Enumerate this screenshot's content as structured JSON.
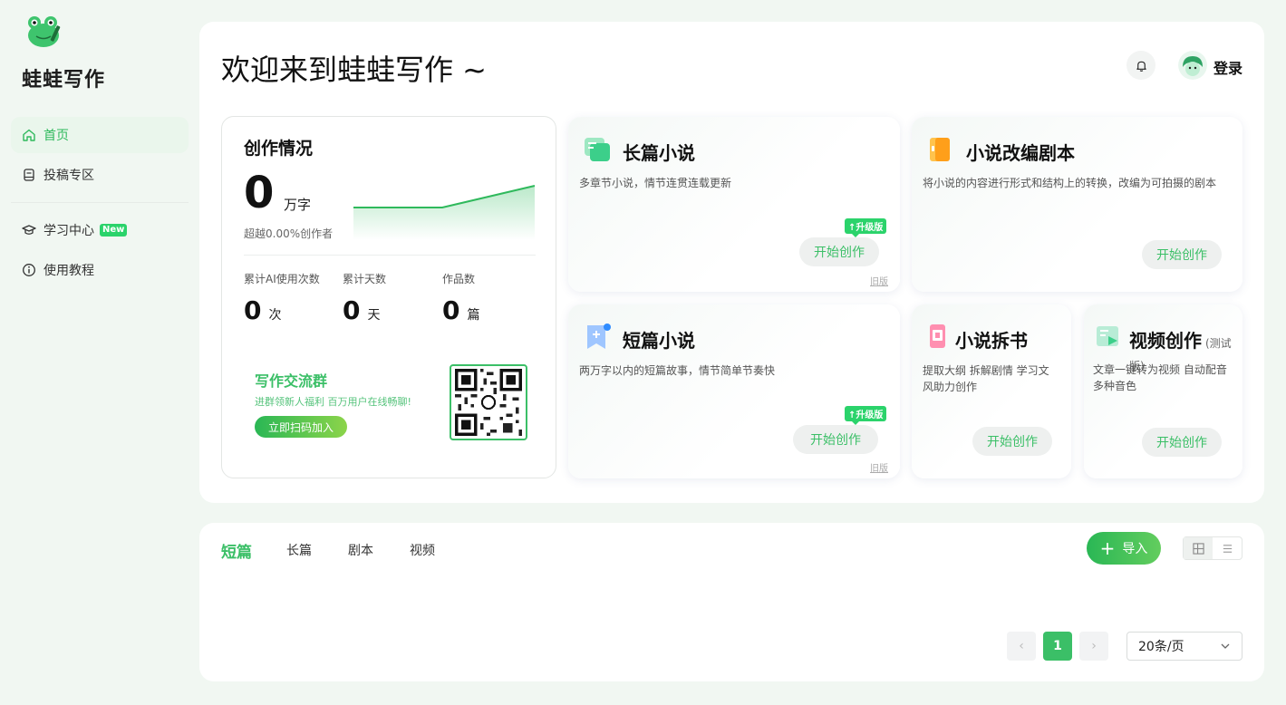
{
  "brand": {
    "name": "蛙蛙写作"
  },
  "sidebar": {
    "items": [
      {
        "label": "首页",
        "icon": "home-icon",
        "active": true
      },
      {
        "label": "投稿专区",
        "icon": "submit-icon"
      },
      {
        "label": "学习中心",
        "icon": "graduation-cap-icon",
        "badge": "New"
      },
      {
        "label": "使用教程",
        "icon": "info-icon"
      }
    ]
  },
  "header": {
    "welcome": "欢迎来到蛙蛙写作 ~",
    "login": "登录"
  },
  "stats": {
    "title": "创作情况",
    "words": "0",
    "words_unit": "万字",
    "beat": "超越0.00%创作者",
    "metrics": [
      {
        "label": "累计AI使用次数",
        "value": "0",
        "unit": "次"
      },
      {
        "label": "累计天数",
        "value": "0",
        "unit": "天"
      },
      {
        "label": "作品数",
        "value": "0",
        "unit": "篇"
      }
    ],
    "group_title": "写作交流群",
    "group_sub": "进群领新人福利 百万用户在线畅聊!",
    "join_label": "立即扫码加入"
  },
  "cards": {
    "long": {
      "title": "长篇小说",
      "desc": "多章节小说，情节连贯连载更新",
      "badge": "升级版",
      "button": "开始创作",
      "old": "旧版"
    },
    "adapt": {
      "title": "小说改编剧本",
      "desc": "将小说的内容进行形式和结构上的转换，改编为可拍摄的剧本",
      "button": "开始创作"
    },
    "short": {
      "title": "短篇小说",
      "desc": "两万字以内的短篇故事，情节简单节奏快",
      "badge": "升级版",
      "button": "开始创作",
      "old": "旧版"
    },
    "split": {
      "title": "小说拆书",
      "desc": "提取大纲 拆解剧情 学习文风助力创作",
      "button": "开始创作"
    },
    "video": {
      "title": "视频创作",
      "tag": "(测试版)",
      "desc": "文章一键转为视频 自动配音多种音色",
      "button": "开始创作"
    }
  },
  "works": {
    "tabs": [
      "短篇",
      "长篇",
      "剧本",
      "视频"
    ],
    "import_label": "导入",
    "page_current": "1",
    "page_size": "20条/页"
  },
  "colors": {
    "accent": "#3bbf67",
    "badge": "#2bd36b"
  }
}
